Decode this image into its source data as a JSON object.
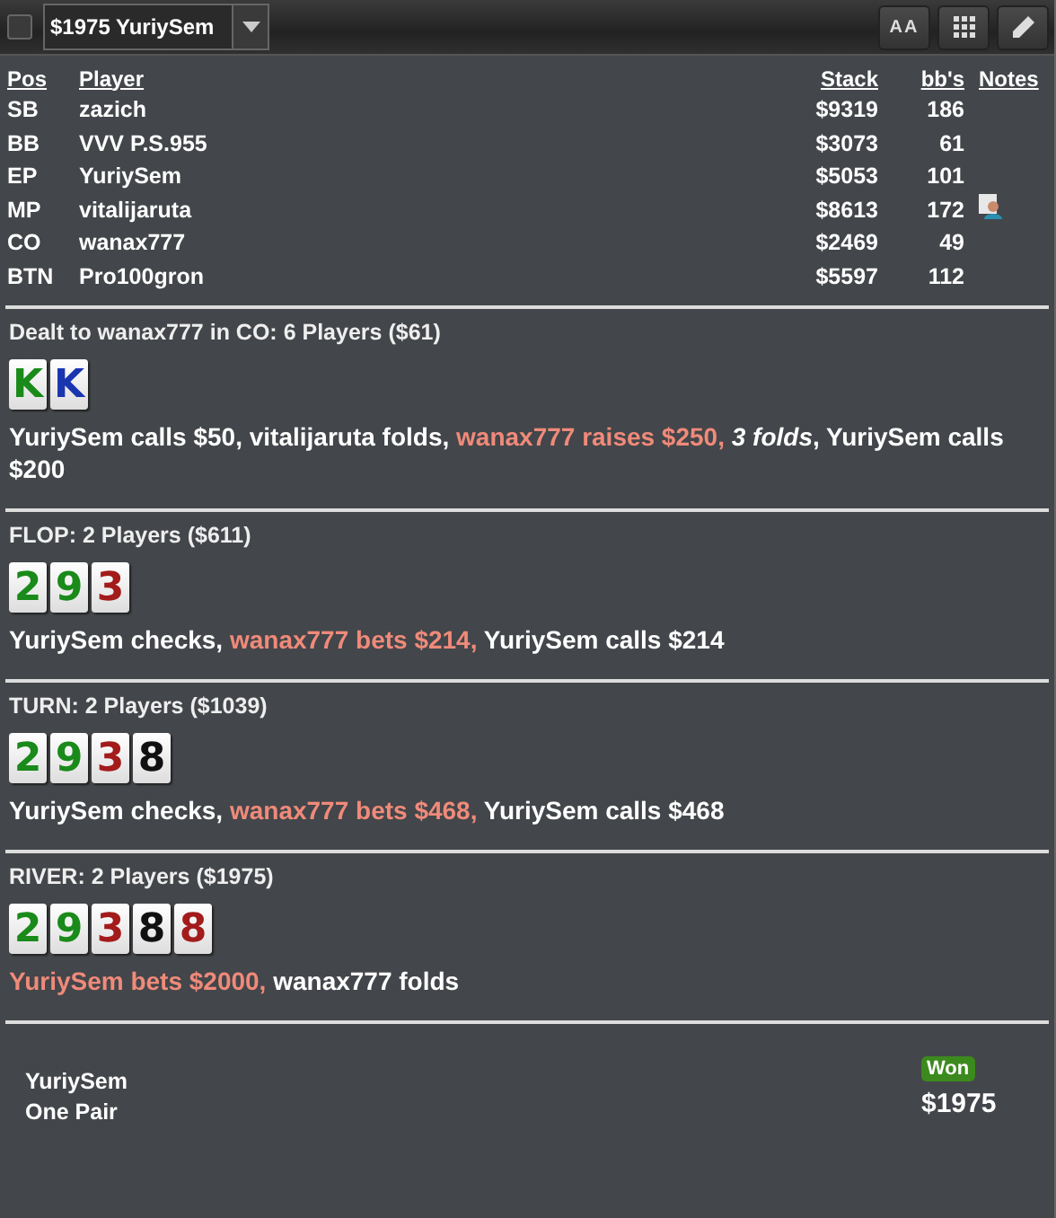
{
  "toolbar": {
    "checkbox": {
      "checked": false
    },
    "hand_select": {
      "value": "$1975 YuriySem"
    },
    "buttons": [
      {
        "kind": "font-size",
        "label": "AA"
      },
      {
        "kind": "grid"
      },
      {
        "kind": "edit"
      }
    ]
  },
  "table": {
    "columns": [
      "Pos",
      "Player",
      "Stack",
      "bb's",
      "Notes"
    ],
    "rows": [
      {
        "pos": "SB",
        "player": "zazich",
        "stack": "$9319",
        "bbs": "186",
        "has_note": false
      },
      {
        "pos": "BB",
        "player": "VVV P.S.955",
        "stack": "$3073",
        "bbs": "61",
        "has_note": false
      },
      {
        "pos": "EP",
        "player": "YuriySem",
        "stack": "$5053",
        "bbs": "101",
        "has_note": false
      },
      {
        "pos": "MP",
        "player": "vitalijaruta",
        "stack": "$8613",
        "bbs": "172",
        "has_note": true
      },
      {
        "pos": "CO",
        "player": "wanax777",
        "stack": "$2469",
        "bbs": "49",
        "has_note": false
      },
      {
        "pos": "BTN",
        "player": "Pro100gron",
        "stack": "$5597",
        "bbs": "112",
        "has_note": false
      }
    ]
  },
  "streets": [
    {
      "title": "Dealt to wanax777 in CO: 6 Players ($61)",
      "cards": [
        {
          "rank": "K",
          "color": "#1a8a1a"
        },
        {
          "rank": "K",
          "color": "#1a35b0"
        }
      ],
      "actions": [
        {
          "text": "YuriySem calls $50, vitalijaruta folds, ",
          "kind": "plain"
        },
        {
          "text": "wanax777 raises $250, ",
          "kind": "aggressive"
        },
        {
          "text": "3 folds",
          "kind": "emphasis"
        },
        {
          "text": ", YuriySem calls $200",
          "kind": "plain"
        }
      ]
    },
    {
      "title": "FLOP: 2 Players ($611)",
      "cards": [
        {
          "rank": "2",
          "color": "#1a8a1a"
        },
        {
          "rank": "9",
          "color": "#1a8a1a"
        },
        {
          "rank": "3",
          "color": "#a31b1b"
        }
      ],
      "actions": [
        {
          "text": "YuriySem checks, ",
          "kind": "plain"
        },
        {
          "text": "wanax777 bets $214, ",
          "kind": "aggressive"
        },
        {
          "text": "YuriySem calls $214",
          "kind": "plain"
        }
      ]
    },
    {
      "title": "TURN: 2 Players ($1039)",
      "cards": [
        {
          "rank": "2",
          "color": "#1a8a1a"
        },
        {
          "rank": "9",
          "color": "#1a8a1a"
        },
        {
          "rank": "3",
          "color": "#a31b1b"
        },
        {
          "rank": "8",
          "color": "#111111"
        }
      ],
      "actions": [
        {
          "text": "YuriySem checks, ",
          "kind": "plain"
        },
        {
          "text": "wanax777 bets $468, ",
          "kind": "aggressive"
        },
        {
          "text": "YuriySem calls $468",
          "kind": "plain"
        }
      ]
    },
    {
      "title": "RIVER: 2 Players ($1975)",
      "cards": [
        {
          "rank": "2",
          "color": "#1a8a1a"
        },
        {
          "rank": "9",
          "color": "#1a8a1a"
        },
        {
          "rank": "3",
          "color": "#a31b1b"
        },
        {
          "rank": "8",
          "color": "#111111"
        },
        {
          "rank": "8",
          "color": "#a31b1b"
        }
      ],
      "actions": [
        {
          "text": "YuriySem bets $2000, ",
          "kind": "aggressive"
        },
        {
          "text": "wanax777 folds",
          "kind": "plain"
        }
      ]
    }
  ],
  "summary": {
    "player": "YuriySem",
    "hand": "One Pair",
    "result": "Won",
    "amount": "$1975"
  }
}
